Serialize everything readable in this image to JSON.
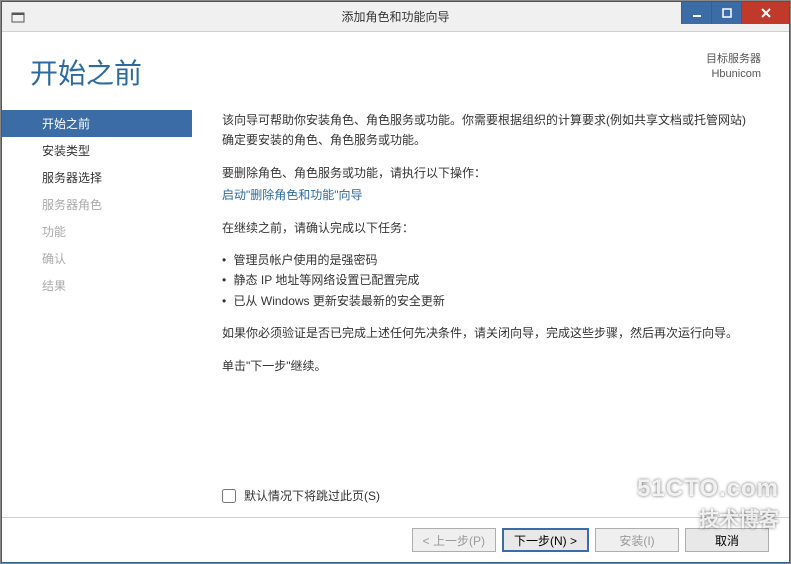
{
  "window": {
    "title": "添加角色和功能向导"
  },
  "header": {
    "page_title": "开始之前",
    "dest_label": "目标服务器",
    "dest_server": "Hbunicom"
  },
  "sidebar": {
    "items": [
      {
        "label": "开始之前",
        "state": "active"
      },
      {
        "label": "安装类型",
        "state": "enabled"
      },
      {
        "label": "服务器选择",
        "state": "enabled"
      },
      {
        "label": "服务器角色",
        "state": "disabled"
      },
      {
        "label": "功能",
        "state": "disabled"
      },
      {
        "label": "确认",
        "state": "disabled"
      },
      {
        "label": "结果",
        "state": "disabled"
      }
    ]
  },
  "main": {
    "intro": "该向导可帮助你安装角色、角色服务或功能。你需要根据组织的计算要求(例如共享文档或托管网站)确定要安装的角色、角色服务或功能。",
    "remove_label": "要删除角色、角色服务或功能，请执行以下操作：",
    "remove_link": "启动\"删除角色和功能\"向导",
    "confirm_label": "在继续之前，请确认完成以下任务：",
    "bullets": [
      "管理员帐户使用的是强密码",
      "静态 IP 地址等网络设置已配置完成",
      "已从 Windows 更新安装最新的安全更新"
    ],
    "verify_note": "如果你必须验证是否已完成上述任何先决条件，请关闭向导，完成这些步骤，然后再次运行向导。",
    "continue_note": "单击\"下一步\"继续。",
    "skip_label": "默认情况下将跳过此页(S)"
  },
  "footer": {
    "prev": "< 上一步(P)",
    "next": "下一步(N) >",
    "install": "安装(I)",
    "cancel": "取消"
  },
  "watermark": {
    "line1": "51CTO.com",
    "line2": "技术博客"
  }
}
